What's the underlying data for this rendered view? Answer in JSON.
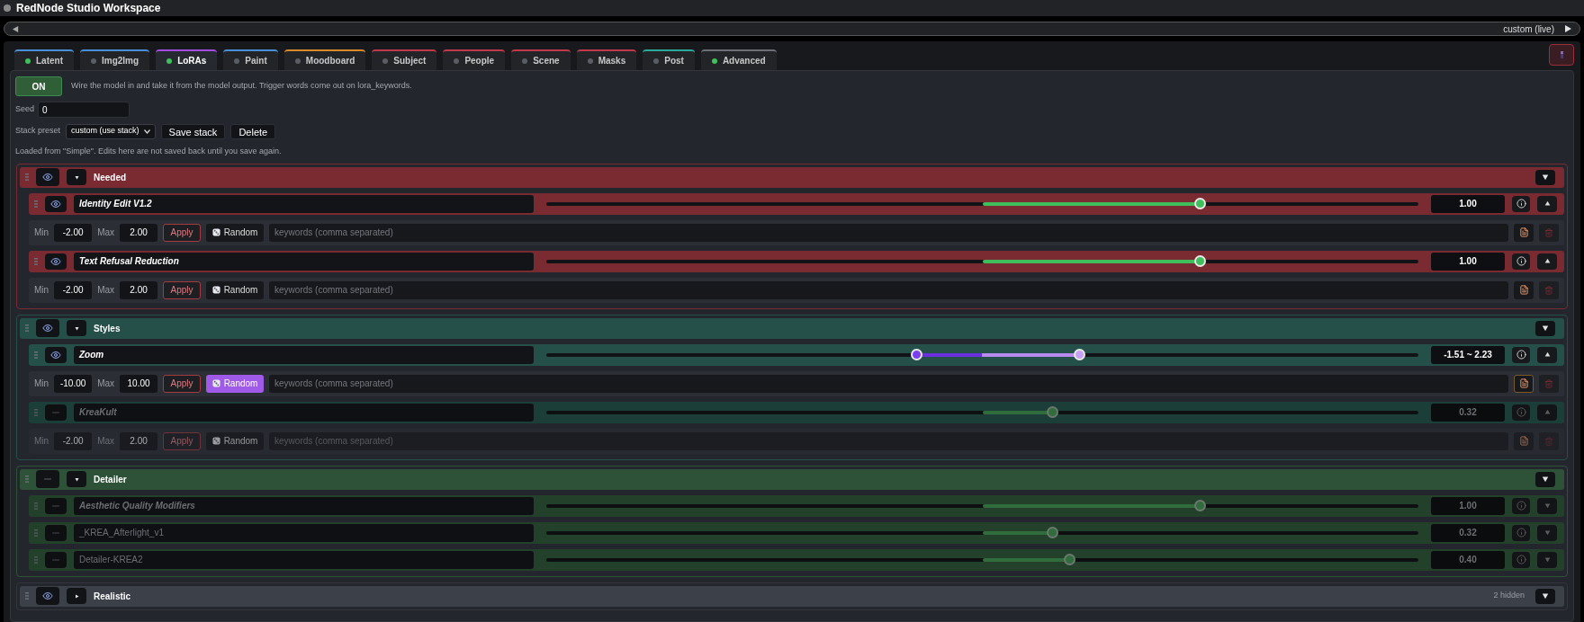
{
  "window": {
    "title": "RedNode Studio Workspace"
  },
  "preset_bar": {
    "value": "custom (live)"
  },
  "tabs": [
    {
      "label": "Latent",
      "selected": false,
      "active": true,
      "color": "#4a8fd6"
    },
    {
      "label": "Img2Img",
      "selected": false,
      "active": false,
      "color": "#4a8fd6"
    },
    {
      "label": "LoRAs",
      "selected": true,
      "active": true,
      "color": "#a44be0"
    },
    {
      "label": "Paint",
      "selected": false,
      "active": false,
      "color": "#4a8fd6"
    },
    {
      "label": "Moodboard",
      "selected": false,
      "active": false,
      "color": "#d98a2a"
    },
    {
      "label": "Subject",
      "selected": false,
      "active": false,
      "color": "#c0394a"
    },
    {
      "label": "People",
      "selected": false,
      "active": false,
      "color": "#c0394a"
    },
    {
      "label": "Scene",
      "selected": false,
      "active": false,
      "color": "#c0394a"
    },
    {
      "label": "Masks",
      "selected": false,
      "active": false,
      "color": "#c0394a"
    },
    {
      "label": "Post",
      "selected": false,
      "active": false,
      "color": "#2aa899"
    },
    {
      "label": "Advanced",
      "selected": false,
      "active": true,
      "color": "#6b6f78"
    }
  ],
  "power_button": {
    "label": "ON",
    "on": true
  },
  "hint": "Wire the model in and take it from the model output. Trigger words come out on lora_keywords.",
  "seed": {
    "label": "Seed",
    "value": "0"
  },
  "stack_preset": {
    "label": "Stack preset",
    "value": "custom (use stack)",
    "buttons": [
      "Save stack",
      "Delete"
    ]
  },
  "notice": "Loaded from \"Simple\". Edits here are not saved back until you save again.",
  "groups": [
    {
      "title": "Needed",
      "color": "#7a2a31",
      "visible": true,
      "expanded": true,
      "rows": [
        {
          "kind": "single",
          "name": "Identity Edit V1.2",
          "enabled": true,
          "italic": true,
          "expanded": true,
          "level": 0.75,
          "value": "1.00",
          "min": {
            "label": "Min",
            "value": "-2.00"
          },
          "max": {
            "label": "Max",
            "value": "2.00"
          },
          "apply": "Apply",
          "random": {
            "label": "Random",
            "on": false
          },
          "keywords_placeholder": "keywords (comma separated)"
        },
        {
          "kind": "single",
          "name": "Text Refusal Reduction",
          "enabled": true,
          "italic": true,
          "expanded": true,
          "level": 0.75,
          "value": "1.00",
          "min": {
            "label": "Min",
            "value": "-2.00"
          },
          "max": {
            "label": "Max",
            "value": "2.00"
          },
          "apply": "Apply",
          "random": {
            "label": "Random",
            "on": false
          },
          "keywords_placeholder": "keywords (comma separated)"
        }
      ]
    },
    {
      "title": "Styles",
      "color": "#245049",
      "visible": true,
      "expanded": true,
      "rows": [
        {
          "kind": "range",
          "name": "Zoom",
          "enabled": true,
          "italic": true,
          "expanded": true,
          "thumbs": [
            {
              "level": 0.4245
            },
            {
              "level": 0.6115
            }
          ],
          "value": "-1.51 ~ 2.23",
          "min": {
            "label": "Min",
            "value": "-10.00"
          },
          "max": {
            "label": "Max",
            "value": "10.00"
          },
          "apply": "Apply",
          "random": {
            "label": "Random",
            "on": true
          },
          "keywords_placeholder": "keywords (comma separated)"
        },
        {
          "kind": "single",
          "name": "KreaKult",
          "enabled": false,
          "italic": true,
          "expanded": true,
          "level": 0.58,
          "value": "0.32",
          "min": {
            "label": "Min",
            "value": "-2.00"
          },
          "max": {
            "label": "Max",
            "value": "2.00"
          },
          "apply": "Apply",
          "random": {
            "label": "Random",
            "on": false
          },
          "keywords_placeholder": "keywords (comma separated)"
        }
      ]
    },
    {
      "title": "Detailer",
      "color": "#2d5237",
      "visible": false,
      "expanded": true,
      "rows": [
        {
          "kind": "single",
          "name": "Aesthetic Quality Modifiers",
          "enabled": false,
          "italic": true,
          "expanded": false,
          "level": 0.75,
          "value": "1.00"
        },
        {
          "kind": "single",
          "name": "_KREA_Afterlight_v1",
          "enabled": false,
          "italic": false,
          "expanded": false,
          "level": 0.58,
          "value": "0.32"
        },
        {
          "kind": "single",
          "name": "Detailer-KREA2",
          "enabled": false,
          "italic": false,
          "expanded": false,
          "level": 0.6,
          "value": "0.40"
        }
      ]
    },
    {
      "title": "Realistic",
      "color": "#3b4049",
      "visible": true,
      "expanded": false,
      "hidden_count": "2 hidden"
    }
  ]
}
